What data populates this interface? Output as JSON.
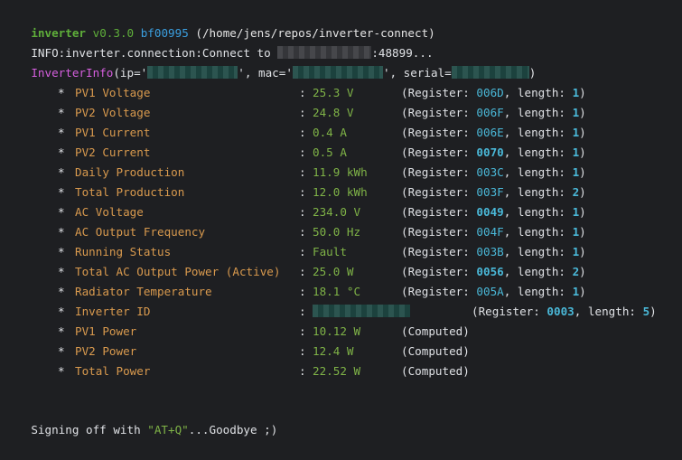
{
  "header": {
    "app": "inverter",
    "version": "v0.3.0",
    "commit": "bf00995",
    "path": "(/home/jens/repos/inverter-connect)"
  },
  "info_line": {
    "prefix": "INFO:inverter.connection:Connect to ",
    "suffix": ":48899..."
  },
  "inverter_info": {
    "class_name": "InverterInfo",
    "ip_key": "(ip='",
    "mac_key": "', mac='",
    "serial_key": "', serial=",
    "close": ")"
  },
  "rows": [
    {
      "label": "PV1 Voltage",
      "value": "25.3 V",
      "register": "006D",
      "reg_bold": false,
      "length": "1"
    },
    {
      "label": "PV2 Voltage",
      "value": "24.8 V",
      "register": "006F",
      "reg_bold": false,
      "length": "1"
    },
    {
      "label": "PV1 Current",
      "value": "0.4 A",
      "register": "006E",
      "reg_bold": false,
      "length": "1"
    },
    {
      "label": "PV2 Current",
      "value": "0.5 A",
      "register": "0070",
      "reg_bold": true,
      "length": "1"
    },
    {
      "label": "Daily Production",
      "value": "11.9 kWh",
      "register": "003C",
      "reg_bold": false,
      "length": "1"
    },
    {
      "label": "Total Production",
      "value": "12.0 kWh",
      "register": "003F",
      "reg_bold": false,
      "length": "2"
    },
    {
      "label": "AC Voltage",
      "value": "234.0 V",
      "register": "0049",
      "reg_bold": true,
      "length": "1"
    },
    {
      "label": "AC Output Frequency",
      "value": "50.0 Hz",
      "register": "004F",
      "reg_bold": false,
      "length": "1"
    },
    {
      "label": "Running Status",
      "value": "Fault",
      "register": "003B",
      "reg_bold": false,
      "length": "1"
    },
    {
      "label": "Total AC Output Power (Active)",
      "value": "25.0 W",
      "register": "0056",
      "reg_bold": true,
      "length": "2"
    },
    {
      "label": "Radiator Temperature",
      "value": "18.1 °C",
      "register": "005A",
      "reg_bold": false,
      "length": "1"
    },
    {
      "label": "Inverter ID",
      "value": "",
      "redacted": true,
      "register": "0003",
      "reg_bold": true,
      "length": "5"
    },
    {
      "label": "PV1 Power",
      "value": "10.12 W",
      "computed": true
    },
    {
      "label": "PV2 Power",
      "value": "12.4 W",
      "computed": true
    },
    {
      "label": "Total Power",
      "value": "22.52 W",
      "computed": true
    }
  ],
  "strings": {
    "bullet": "*",
    "colon": ":",
    "register_prefix": "(Register: ",
    "length_prefix": ", length: ",
    "close": ")",
    "computed": "(Computed)"
  },
  "footer": {
    "prefix": "Signing off with ",
    "command": "\"AT+Q\"",
    "suffix": "...Goodbye ;)"
  },
  "colors": {
    "background": "#1e1f22",
    "label": "#d99a4e",
    "value": "#7fb347",
    "register_number": "#4ab8d8",
    "class_name": "#d55fde"
  }
}
